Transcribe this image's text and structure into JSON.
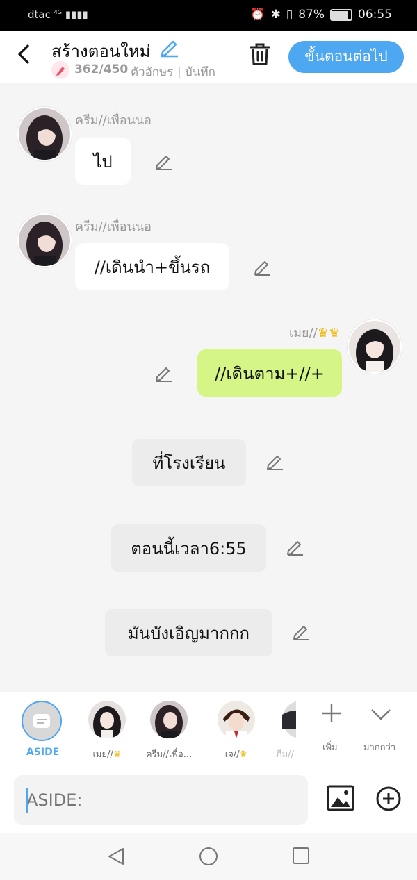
{
  "status_bar": {
    "carrier": "dtac",
    "network": "4G",
    "battery": "87%",
    "time": "06:55"
  },
  "header": {
    "title": "สร้างตอนใหม่",
    "counter": "362/450",
    "counter_suffix": "ตัวอักษร | บันทึก",
    "next_label": "ขั้นตอนต่อไป"
  },
  "messages": [
    {
      "type": "left",
      "name": "ครีม//เพื่อนนอ",
      "text": "ไป"
    },
    {
      "type": "left",
      "name": "ครีม//เพื่อนนอ",
      "text": "//เดินนำ+ขึ้นรถ"
    },
    {
      "type": "right",
      "name": "เมย//",
      "badge": "crown",
      "text": "//เดินตาม+//+"
    },
    {
      "type": "aside",
      "text": "ที่โรงเรียน"
    },
    {
      "type": "aside",
      "text": "ตอนนี้เวลา6:55"
    },
    {
      "type": "aside",
      "text": "มันบังเอิญมากกก"
    }
  ],
  "characters": {
    "aside_label": "ASIDE",
    "items": [
      {
        "label": "เมย//",
        "badge": "crown"
      },
      {
        "label": "ครีม//เพื่อ..."
      },
      {
        "label": "เจ//",
        "badge": "crown"
      },
      {
        "label": "ภีม//"
      }
    ],
    "add_label": "เพิ่ม",
    "more_label": "มากกว่า"
  },
  "input": {
    "placeholder": "ASIDE:"
  },
  "colors": {
    "accent": "#4ea7f1",
    "green_bubble": "#d6f587",
    "crown": "#f2b400"
  }
}
